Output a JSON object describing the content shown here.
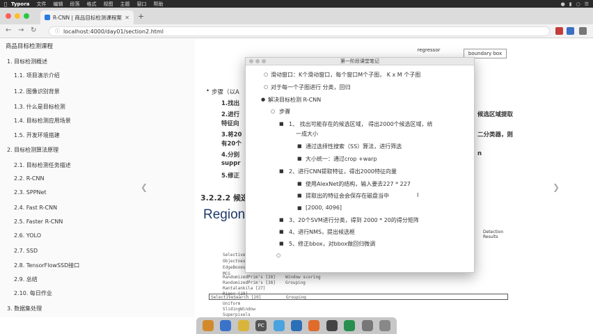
{
  "menubar": {
    "app": "Typora",
    "items": [
      "文件",
      "编辑",
      "段落",
      "格式",
      "视图",
      "主题",
      "窗口",
      "帮助"
    ]
  },
  "browser": {
    "tab_title": "R-CNN | 商品目标检测课程案例",
    "url": "localhost:4000/day01/section2.html"
  },
  "sidebar": {
    "title": "商品目标检测课程",
    "items": [
      "1. 目标检测概述",
      "1.1. 项目演示介绍",
      "1.2. 图像识别背景",
      "1.3. 什么是目标检测",
      "1.4. 目标检测应用场景",
      "1.5. 开发环境搭建",
      "2. 目标检测算法原理",
      "2.1. 目标检测任务描述",
      "2.2. R-CNN",
      "2.3. SPPNet",
      "2.4. Fast R-CNN",
      "2.5. Faster R-CNN",
      "2.6. YOLO",
      "2.7. SSD",
      "2.8. TensorFlowSSD接口",
      "2.9. 总结",
      "2.10. 每日作业",
      "3. 数据集处理"
    ]
  },
  "main": {
    "diagram_regressor": "regressor",
    "diagram_bbox": "boundary box",
    "step_label": "步骤（以A",
    "step1": "1.找出",
    "step2": "2.进行",
    "step2b": "特征向",
    "step3": "3.将20",
    "step3b": "有20个",
    "step4": "4.分别",
    "step4b": "suppr",
    "step5": "5.修正",
    "right1": "候选区域提取",
    "right2": "二分类器，则",
    "right3": "n",
    "heading": "3.2.2.2 候选",
    "bigword": "Region",
    "table_col1": "Detection Results",
    "table_rows": [
      "SelectiveSearch",
      "Objectness",
      "EdgeBoxes",
      "MCG",
      "RandomizedPrim's [28]",
      "Rahtu [25]",
      "RandomizedPrim's [38]",
      "Rantalankila [27]",
      "Rigor [28]",
      "SelectiveSearch [29]",
      "Uniform",
      "SlidingWindow",
      "Superpixels"
    ],
    "grouping": "Grouping",
    "window_scoring": "Window scoring"
  },
  "popup": {
    "title": "第一阶段课堂笔记",
    "lines": [
      "滑动窗口：K个滑动窗口，每个窗口M个子图，   K x M 个子图",
      "对于每一个子图进行 分类，回归",
      "解决目标检测 R-CNN",
      "步骤",
      "1、 找出可能存在的候选区域，  得出2000个候选区域，统",
      "一成大小",
      "通过选择性搜索（SS）算法，进行筛选",
      "大小统一：通过crop +warp",
      "2、进行CNN提取特征，得出2000特征向量",
      "使用AlexNet的结构，输入要去227 * 227",
      "提取出的特征会会保存在磁盘当中",
      "[2000,  4096]",
      "3、20个SVM进行分类，得到 2000 * 20的得分矩阵",
      "4、进行NMS，提出候选框",
      "5、修正bbox，对bbox做回归微调"
    ]
  },
  "dock": {
    "labels": [
      "PC"
    ]
  }
}
